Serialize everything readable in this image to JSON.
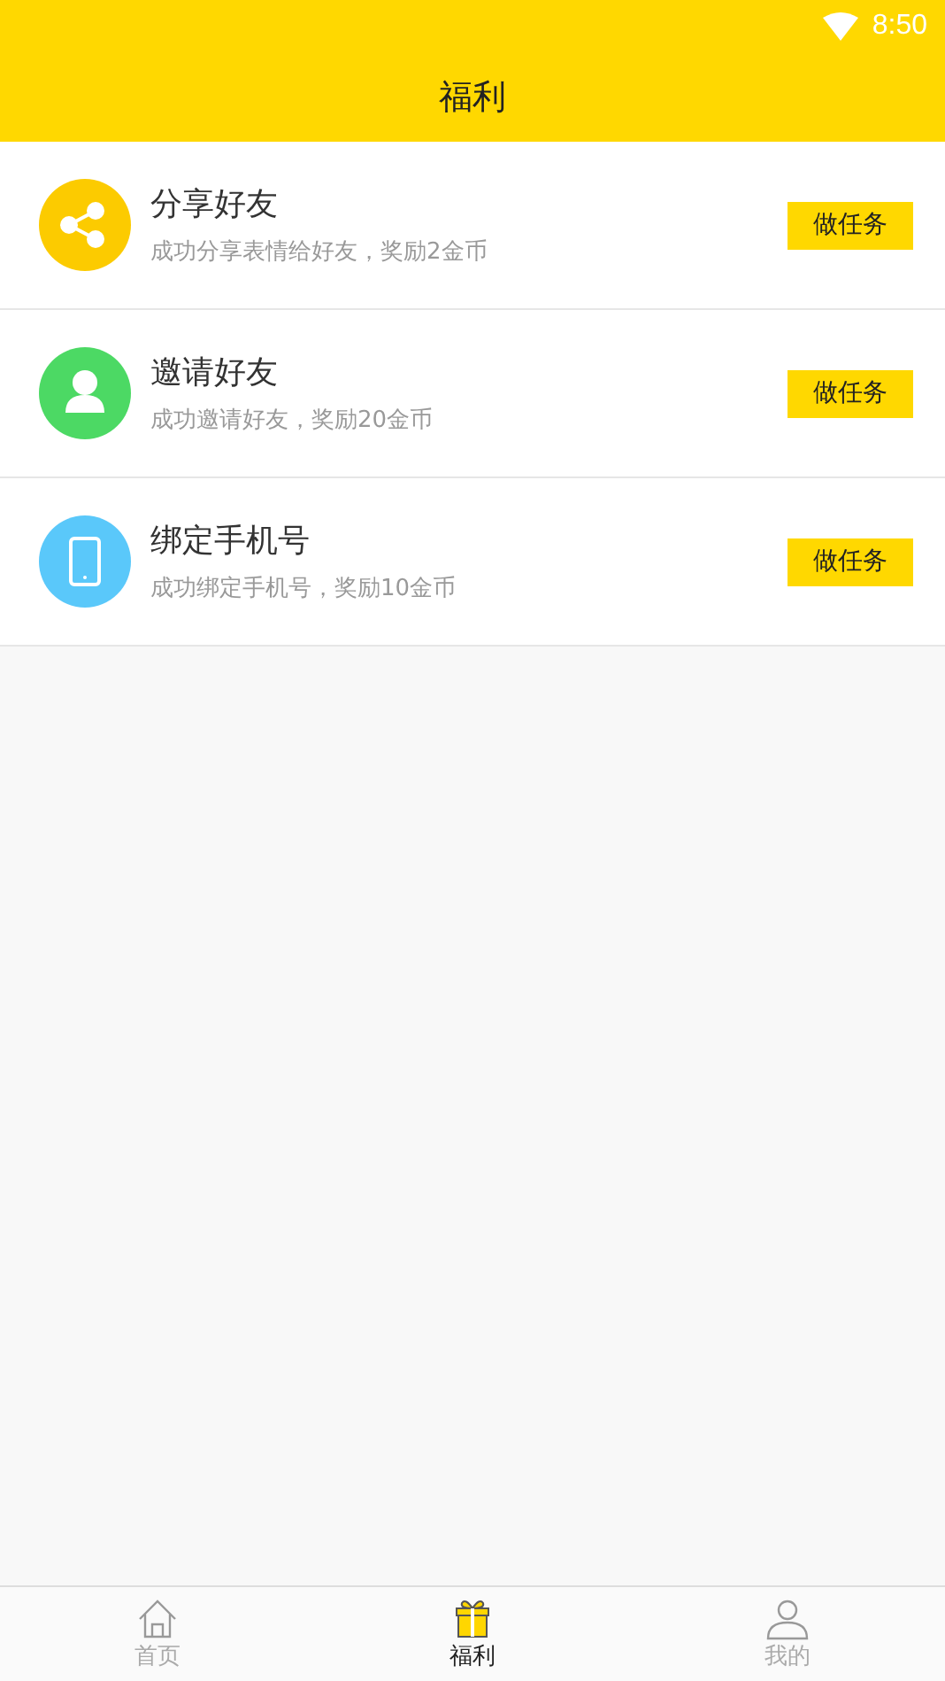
{
  "status_bar": {
    "time": "8:50"
  },
  "header": {
    "title": "福利"
  },
  "tasks": [
    {
      "kind": "share",
      "color": "#fccb00",
      "title": "分享好友",
      "description": "成功分享表情给好友，奖励2金币",
      "button": "做任务"
    },
    {
      "kind": "invite",
      "color": "#4cd964",
      "title": "邀请好友",
      "description": "成功邀请好友，奖励20金币",
      "button": "做任务"
    },
    {
      "kind": "phone",
      "color": "#5ac8fa",
      "title": "绑定手机号",
      "description": "成功绑定手机号，奖励10金币",
      "button": "做任务"
    }
  ],
  "tabs": [
    {
      "kind": "home",
      "label": "首页",
      "selected": false
    },
    {
      "kind": "gift",
      "label": "福利",
      "selected": true
    },
    {
      "kind": "user",
      "label": "我的",
      "selected": false
    }
  ]
}
